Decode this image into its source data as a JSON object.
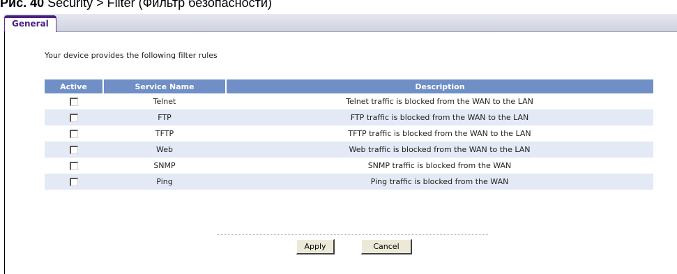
{
  "caption": {
    "figure": "Рис. 40",
    "text": "Security > Filter (Фильтр безопасности)"
  },
  "tabs": [
    {
      "label": "General",
      "active": true
    }
  ],
  "intro_text": "Your device provides the following filter rules",
  "table": {
    "headers": [
      "Active",
      "Service Name",
      "Description"
    ],
    "rows": [
      {
        "active": false,
        "service": "Telnet",
        "description": "Telnet traffic is blocked from the WAN to the LAN"
      },
      {
        "active": false,
        "service": "FTP",
        "description": "FTP traffic is blocked from the WAN to the LAN"
      },
      {
        "active": false,
        "service": "TFTP",
        "description": "TFTP traffic is blocked from the WAN to the LAN"
      },
      {
        "active": false,
        "service": "Web",
        "description": "Web traffic is blocked from the WAN to the LAN"
      },
      {
        "active": false,
        "service": "SNMP",
        "description": "SNMP traffic is blocked from the WAN"
      },
      {
        "active": false,
        "service": "Ping",
        "description": "Ping traffic is blocked from the WAN"
      }
    ]
  },
  "buttons": {
    "apply": "Apply",
    "cancel": "Cancel"
  },
  "colors": {
    "header_bg": "#6f8fc6",
    "alt_row_bg": "#e3e9f5",
    "tab_accent": "#4a1f80"
  }
}
